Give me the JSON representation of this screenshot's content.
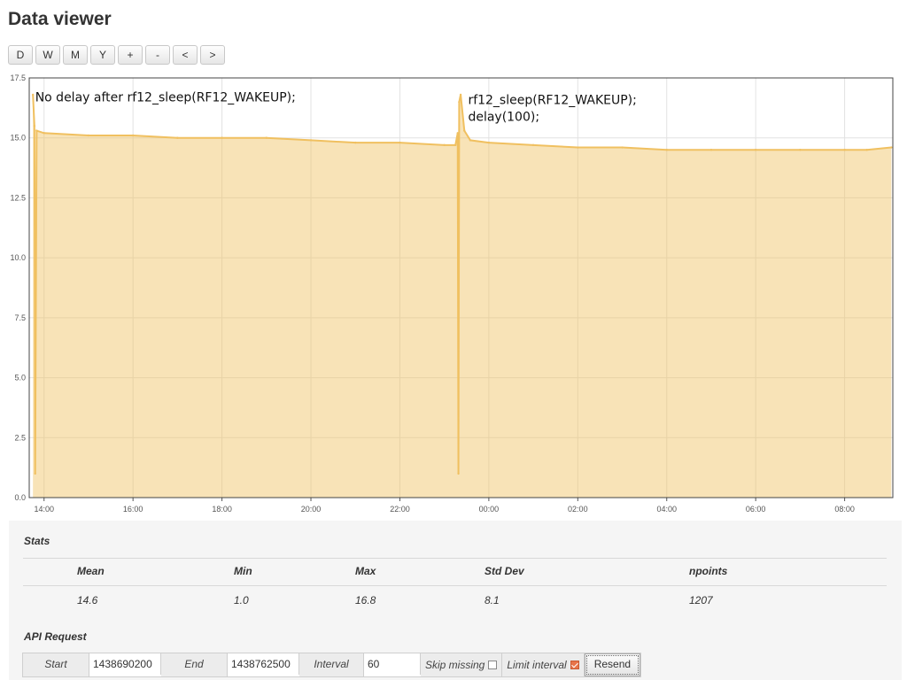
{
  "page": {
    "title": "Data viewer"
  },
  "toolbar": {
    "buttons": [
      {
        "label": "D",
        "name": "range-day-button"
      },
      {
        "label": "W",
        "name": "range-week-button"
      },
      {
        "label": "M",
        "name": "range-month-button"
      },
      {
        "label": "Y",
        "name": "range-year-button"
      },
      {
        "label": "+",
        "name": "zoom-in-button"
      },
      {
        "label": "-",
        "name": "zoom-out-button"
      },
      {
        "label": "<",
        "name": "pan-left-button"
      },
      {
        "label": ">",
        "name": "pan-right-button"
      }
    ]
  },
  "chart_data": {
    "type": "area",
    "title": "",
    "xlabel": "",
    "ylabel": "",
    "xlim": [
      "13:40",
      "09:05"
    ],
    "ylim": [
      0,
      17.5
    ],
    "x_tick_labels": [
      "14:00",
      "16:00",
      "18:00",
      "20:00",
      "22:00",
      "00:00",
      "02:00",
      "04:00",
      "06:00",
      "08:00"
    ],
    "y_tick_labels": [
      "0.0",
      "2.5",
      "5.0",
      "7.5",
      "10.0",
      "12.5",
      "15.0",
      "17.5"
    ],
    "grid": true,
    "annotations": [
      {
        "text": "No delay after rf12_sleep(RF12_WAKEUP);",
        "x": "13:48",
        "y": 16.7
      },
      {
        "text": "rf12_sleep(RF12_WAKEUP);",
        "x": "23:32",
        "y": 16.6
      },
      {
        "text": "delay(100);",
        "x": "23:32",
        "y": 15.9
      }
    ],
    "series": [
      {
        "color": "#f0c060",
        "points": [
          [
            "13:45",
            16.8
          ],
          [
            "13:47",
            15.5
          ],
          [
            "13:48",
            1.0
          ],
          [
            "13:50",
            15.3
          ],
          [
            "14:00",
            15.2
          ],
          [
            "15:00",
            15.1
          ],
          [
            "16:00",
            15.1
          ],
          [
            "17:00",
            15.0
          ],
          [
            "18:00",
            15.0
          ],
          [
            "19:00",
            15.0
          ],
          [
            "20:00",
            14.9
          ],
          [
            "21:00",
            14.8
          ],
          [
            "22:00",
            14.8
          ],
          [
            "23:00",
            14.7
          ],
          [
            "23:15",
            14.7
          ],
          [
            "23:18",
            15.2
          ],
          [
            "23:19",
            1.0
          ],
          [
            "23:20",
            16.5
          ],
          [
            "23:22",
            16.8
          ],
          [
            "23:27",
            15.3
          ],
          [
            "23:35",
            14.9
          ],
          [
            "00:00",
            14.8
          ],
          [
            "01:00",
            14.7
          ],
          [
            "02:00",
            14.6
          ],
          [
            "03:00",
            14.6
          ],
          [
            "04:00",
            14.5
          ],
          [
            "05:00",
            14.5
          ],
          [
            "06:00",
            14.5
          ],
          [
            "07:00",
            14.5
          ],
          [
            "08:00",
            14.5
          ],
          [
            "08:30",
            14.5
          ],
          [
            "09:03",
            14.6
          ]
        ]
      }
    ]
  },
  "stats": {
    "title": "Stats",
    "headers": [
      "Mean",
      "Min",
      "Max",
      "Std Dev",
      "npoints"
    ],
    "values": [
      "14.6",
      "1.0",
      "16.8",
      "8.1",
      "1207"
    ]
  },
  "api": {
    "title": "API Request",
    "start_label": "Start",
    "start_value": "1438690200",
    "end_label": "End",
    "end_value": "1438762500",
    "interval_label": "Interval",
    "interval_value": "60",
    "skip_missing_label": "Skip missing",
    "skip_missing_checked": false,
    "limit_interval_label": "Limit interval",
    "limit_interval_checked": true,
    "resend_label": "Resend"
  }
}
